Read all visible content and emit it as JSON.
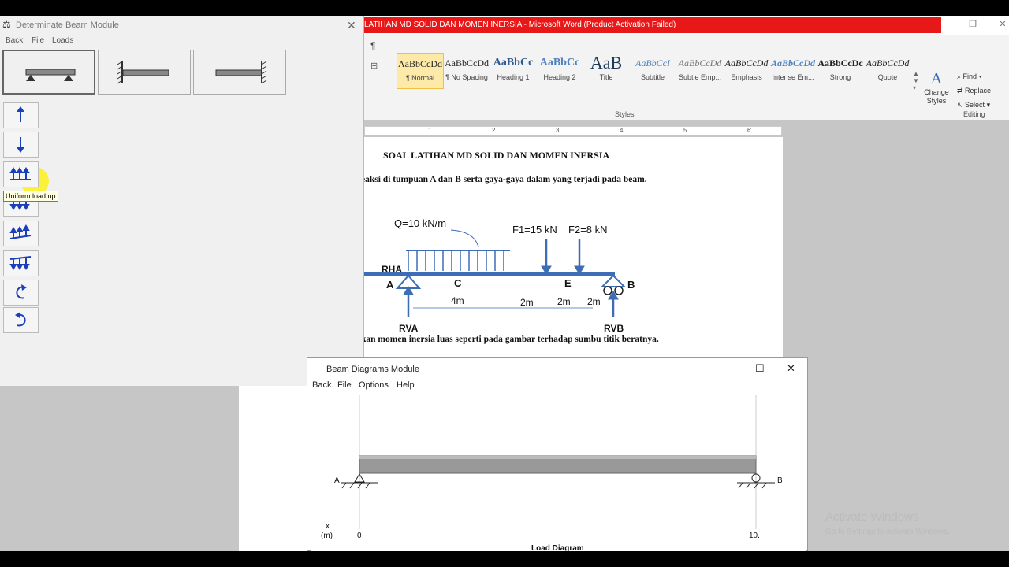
{
  "word": {
    "title": "LATIHAN MD SOLID DAN MOMEN INERSIA - Microsoft Word (Product Activation Failed)",
    "styles": [
      {
        "sample": "AaBbCcDd",
        "name": "¶ Normal"
      },
      {
        "sample": "AaBbCcDd",
        "name": "¶ No Spacing"
      },
      {
        "sample": "AaBbCc",
        "name": "Heading 1"
      },
      {
        "sample": "AaBbCc",
        "name": "Heading 2"
      },
      {
        "sample": "AaB",
        "name": "Title"
      },
      {
        "sample": "AaBbCcI",
        "name": "Subtitle"
      },
      {
        "sample": "AaBbCcDd",
        "name": "Subtle Emp..."
      },
      {
        "sample": "AaBbCcDd",
        "name": "Emphasis"
      },
      {
        "sample": "AaBbCcDd",
        "name": "Intense Em..."
      },
      {
        "sample": "AaBbCcDc",
        "name": "Strong"
      },
      {
        "sample": "AaBbCcDd",
        "name": "Quote"
      }
    ],
    "change_styles": "Change Styles",
    "styles_caption": "Styles",
    "editing_caption": "Editing",
    "editing": [
      "Find",
      "Replace",
      "Select"
    ],
    "ruler_numbers": [
      "1",
      "2",
      "3",
      "4",
      "5",
      "6",
      "7"
    ],
    "doc": {
      "heading": "SOAL LATIHAN MD SOLID DAN MOMEN INERSIA",
      "line1": "eaksi di tumpuan A dan B serta gaya-gaya dalam yang terjadi pada beam.",
      "line2": "kan momen inersia luas seperti pada gambar terhadap sumbu titik beratnya.",
      "fig": {
        "q": "Q=10 kN/m",
        "f1": "F1=15 kN",
        "f2": "F2=8 kN",
        "rha": "RHA",
        "a": "A",
        "c": "C",
        "e": "E",
        "b": "B",
        "d1": "4m",
        "d2": "2m",
        "d3": "2m",
        "d4": "2m",
        "rva": "RVA",
        "rvb": "RVB"
      }
    }
  },
  "beam_module": {
    "title": "Determinate Beam Module",
    "menu": [
      "Back",
      "File",
      "Loads"
    ],
    "tooltip": "Uniform load up"
  },
  "diagram_module": {
    "title": "Beam Diagrams Module",
    "menu": [
      "Back",
      "File",
      "Options",
      "Help"
    ],
    "label_a": "A",
    "label_b": "B",
    "x_label": "x",
    "x_unit": "(m)",
    "x_start": "0",
    "x_end": "10.",
    "caption": "Load Diagram"
  },
  "watermark": {
    "line1": "Activate Windows",
    "line2": "Go to Settings to activate Windows."
  }
}
